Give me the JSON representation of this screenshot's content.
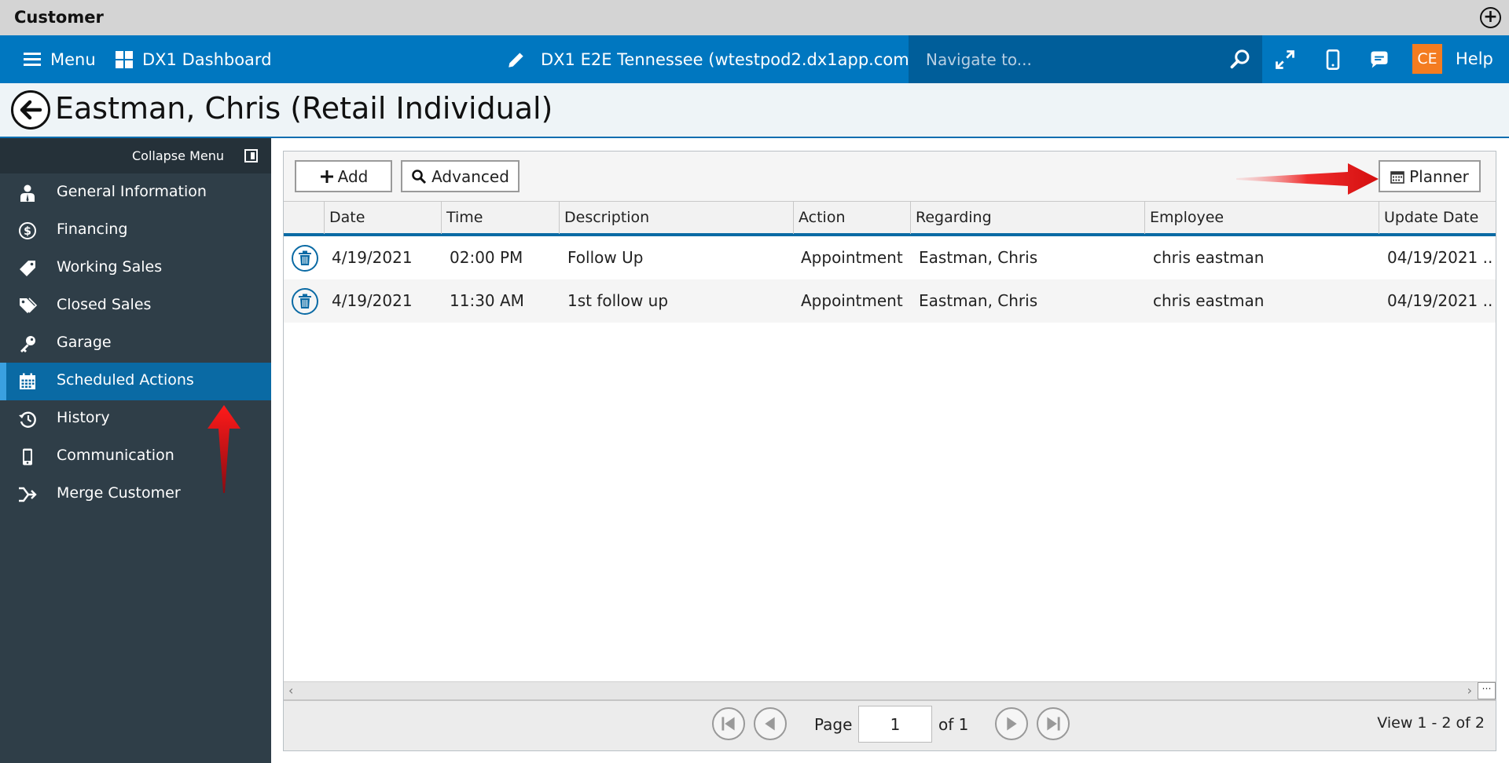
{
  "window": {
    "title": "Customer"
  },
  "topnav": {
    "menu_label": "Menu",
    "dashboard_label": "DX1 Dashboard",
    "location_label": "DX1 E2E Tennessee (wtestpod2.dx1app.com)",
    "search_placeholder": "Navigate to...",
    "avatar_initials": "CE",
    "help_label": "Help"
  },
  "header": {
    "title": "Eastman, Chris (Retail Individual)"
  },
  "sidebar": {
    "collapse_label": "Collapse Menu",
    "items": [
      {
        "label": "General Information",
        "icon": "person-icon"
      },
      {
        "label": "Financing",
        "icon": "dollar-icon"
      },
      {
        "label": "Working Sales",
        "icon": "tag-icon"
      },
      {
        "label": "Closed Sales",
        "icon": "tags-icon"
      },
      {
        "label": "Garage",
        "icon": "key-icon"
      },
      {
        "label": "Scheduled Actions",
        "icon": "calendar-icon",
        "active": true
      },
      {
        "label": "History",
        "icon": "history-icon"
      },
      {
        "label": "Communication",
        "icon": "phone-icon"
      },
      {
        "label": "Merge Customer",
        "icon": "merge-icon"
      }
    ]
  },
  "toolbar": {
    "add_label": "Add",
    "advanced_label": "Advanced",
    "planner_label": "Planner"
  },
  "grid": {
    "columns": [
      "Date",
      "Time",
      "Description",
      "Action",
      "Regarding",
      "Employee",
      "Update Date"
    ],
    "rows": [
      [
        "4/19/2021",
        "02:00 PM",
        "Follow Up",
        "Appointment",
        "Eastman, Chris",
        "chris eastman",
        "04/19/2021 ..."
      ],
      [
        "4/19/2021",
        "11:30 AM",
        "1st follow up",
        "Appointment",
        "Eastman, Chris",
        "chris eastman",
        "04/19/2021 ..."
      ]
    ]
  },
  "pager": {
    "page_label": "Page",
    "page_value": "1",
    "of_label": "of 1",
    "view_label": "View 1 - 2 of 2"
  },
  "colors": {
    "nav_blue": "#0077c0",
    "sidebar_bg": "#2f3e48",
    "active_item": "#0a6aa4",
    "avatar_orange": "#f47c20",
    "annotation_red": "#e31b1b"
  }
}
